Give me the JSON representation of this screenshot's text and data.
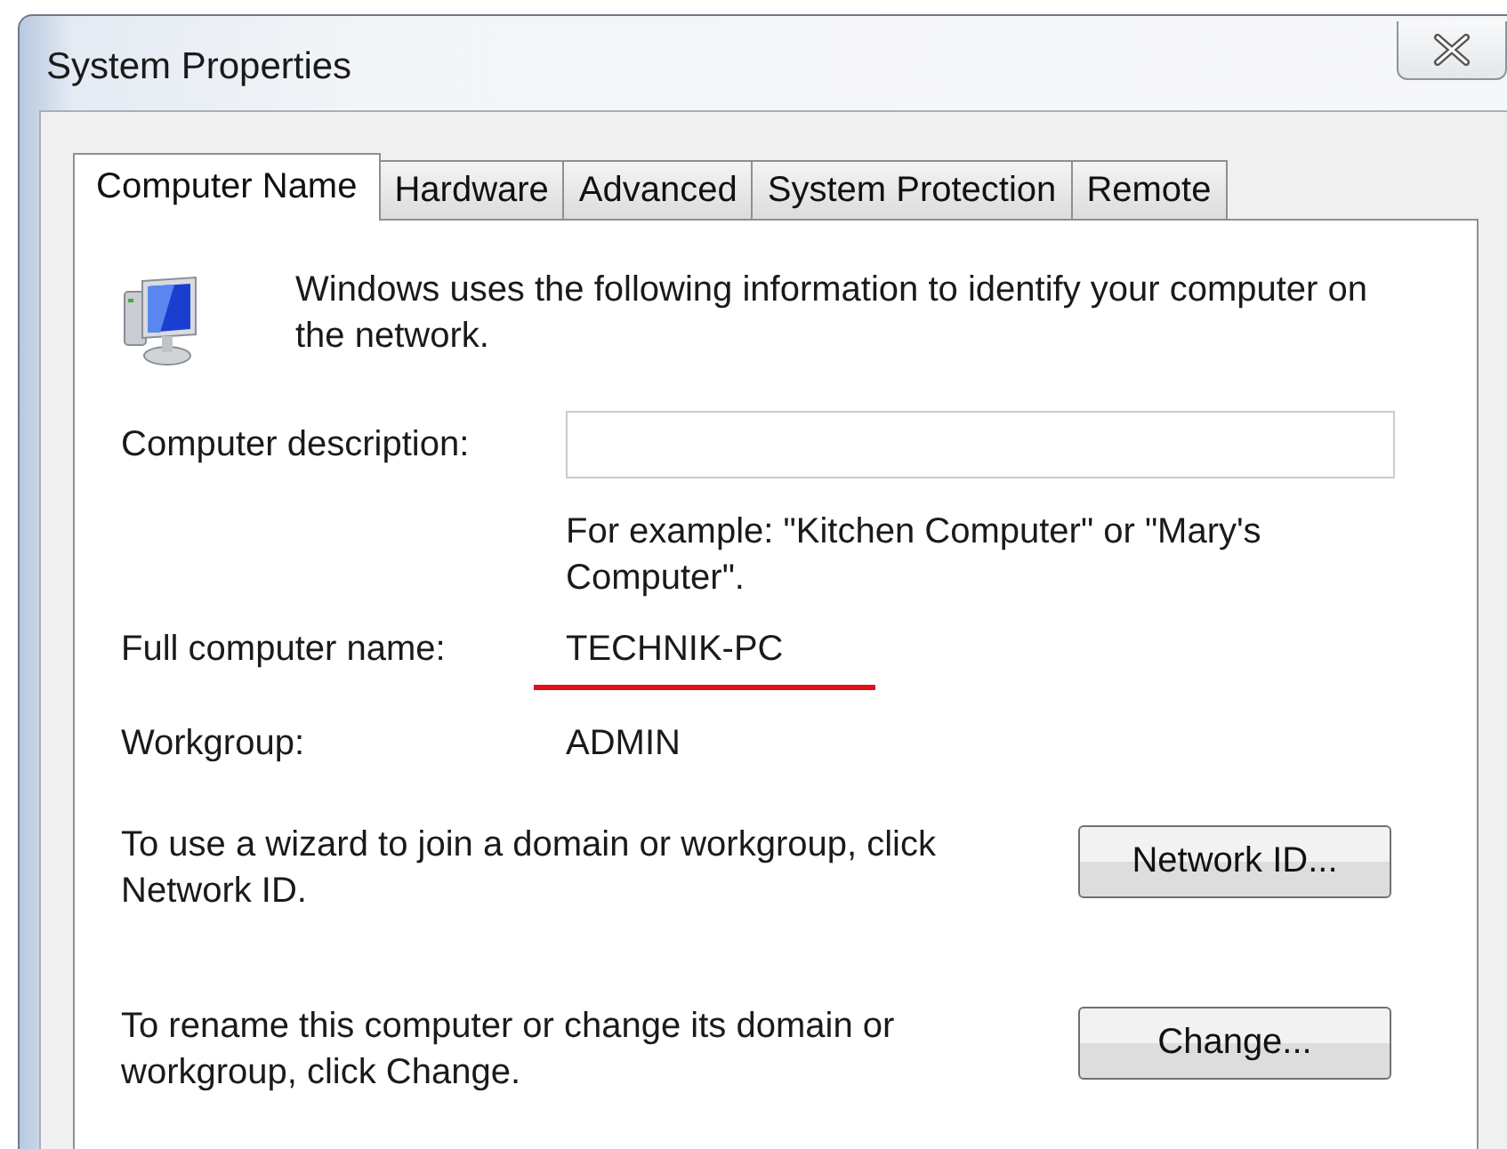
{
  "window": {
    "title": "System Properties"
  },
  "tabs": [
    {
      "label": "Computer Name",
      "selected": true
    },
    {
      "label": "Hardware",
      "selected": false
    },
    {
      "label": "Advanced",
      "selected": false
    },
    {
      "label": "System Protection",
      "selected": false
    },
    {
      "label": "Remote",
      "selected": false
    }
  ],
  "intro": "Windows uses the following information to identify your computer on the network.",
  "description": {
    "label": "Computer description:",
    "hint": "For example: \"Kitchen Computer\" or \"Mary's Computer\"."
  },
  "full_name": {
    "label": "Full computer name:",
    "value": "TECHNIK-PC"
  },
  "workgroup": {
    "label": "Workgroup:",
    "value": "ADMIN"
  },
  "actions": [
    {
      "text": "To use a wizard to join a domain or workgroup, click Network ID.",
      "button": "Network ID..."
    },
    {
      "text": "To rename this computer or change its domain or workgroup, click Change.",
      "button": "Change..."
    }
  ]
}
